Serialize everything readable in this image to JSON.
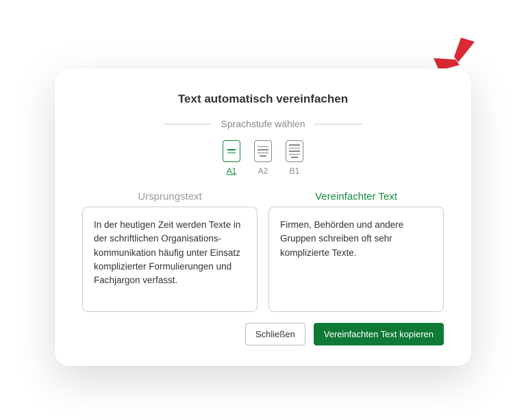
{
  "title": "Text automatisch vereinfachen",
  "subtitle": "Sprachstufe wählen",
  "levels": {
    "a1": "A1",
    "a2": "A2",
    "b1": "B1"
  },
  "columns": {
    "left_header": "Ursprungstext",
    "right_header": "Vereinfachter Text",
    "left_text": "In der heutigen Zeit werden Texte in der schriftlichen Organisations-kommunikation häufig unter Einsatz komplizierter Formulierungen und Fachjargon verfasst.",
    "right_text": "Firmen, Behörden und andere Gruppen schreiben oft sehr komplizierte Texte."
  },
  "actions": {
    "close": "Schließen",
    "copy": "Vereinfachten Text kopieren"
  },
  "colors": {
    "primary": "#0f7a36",
    "accent_red": "#da2a33"
  }
}
